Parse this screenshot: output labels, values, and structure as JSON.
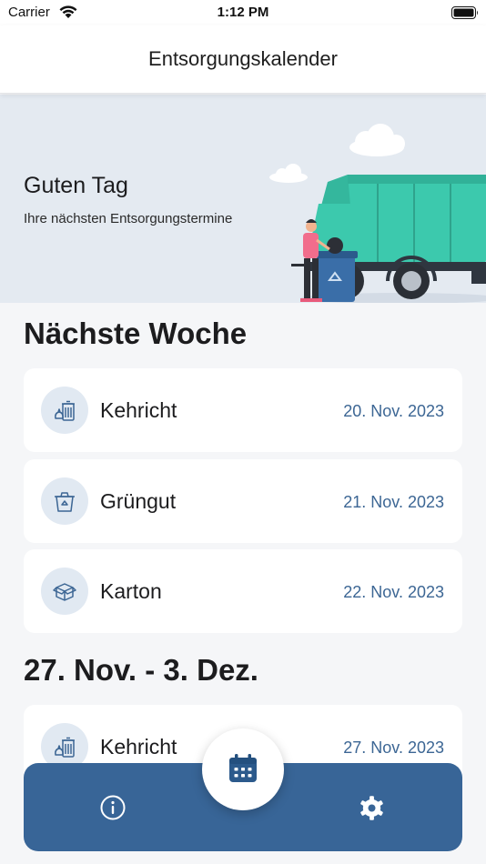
{
  "status_bar": {
    "carrier": "Carrier",
    "time": "1:12 PM"
  },
  "nav": {
    "title": "Entsorgungskalender"
  },
  "hero": {
    "greeting": "Guten Tag",
    "subtitle": "Ihre nächsten Entsorgungstermine"
  },
  "sections": [
    {
      "title": "Nächste Woche",
      "items": [
        {
          "label": "Kehricht",
          "date": "20. Nov. 2023",
          "icon": "trash-bag-bin-icon"
        },
        {
          "label": "Grüngut",
          "date": "21. Nov. 2023",
          "icon": "compost-bin-icon"
        },
        {
          "label": "Karton",
          "date": "22. Nov. 2023",
          "icon": "cardboard-box-icon"
        }
      ]
    },
    {
      "title": "27. Nov. - 3. Dez.",
      "items": [
        {
          "label": "Kehricht",
          "date": "27. Nov. 2023",
          "icon": "trash-bag-bin-icon"
        }
      ]
    }
  ],
  "tab_bar": {
    "left_icon": "info-icon",
    "center_icon": "calendar-icon",
    "right_icon": "gear-icon"
  },
  "colors": {
    "accent": "#386597",
    "date_text": "#3c6694",
    "hero_bg": "#e4eaf1",
    "icon_bg": "#e1e9f2",
    "truck": "#3cc9ad"
  }
}
